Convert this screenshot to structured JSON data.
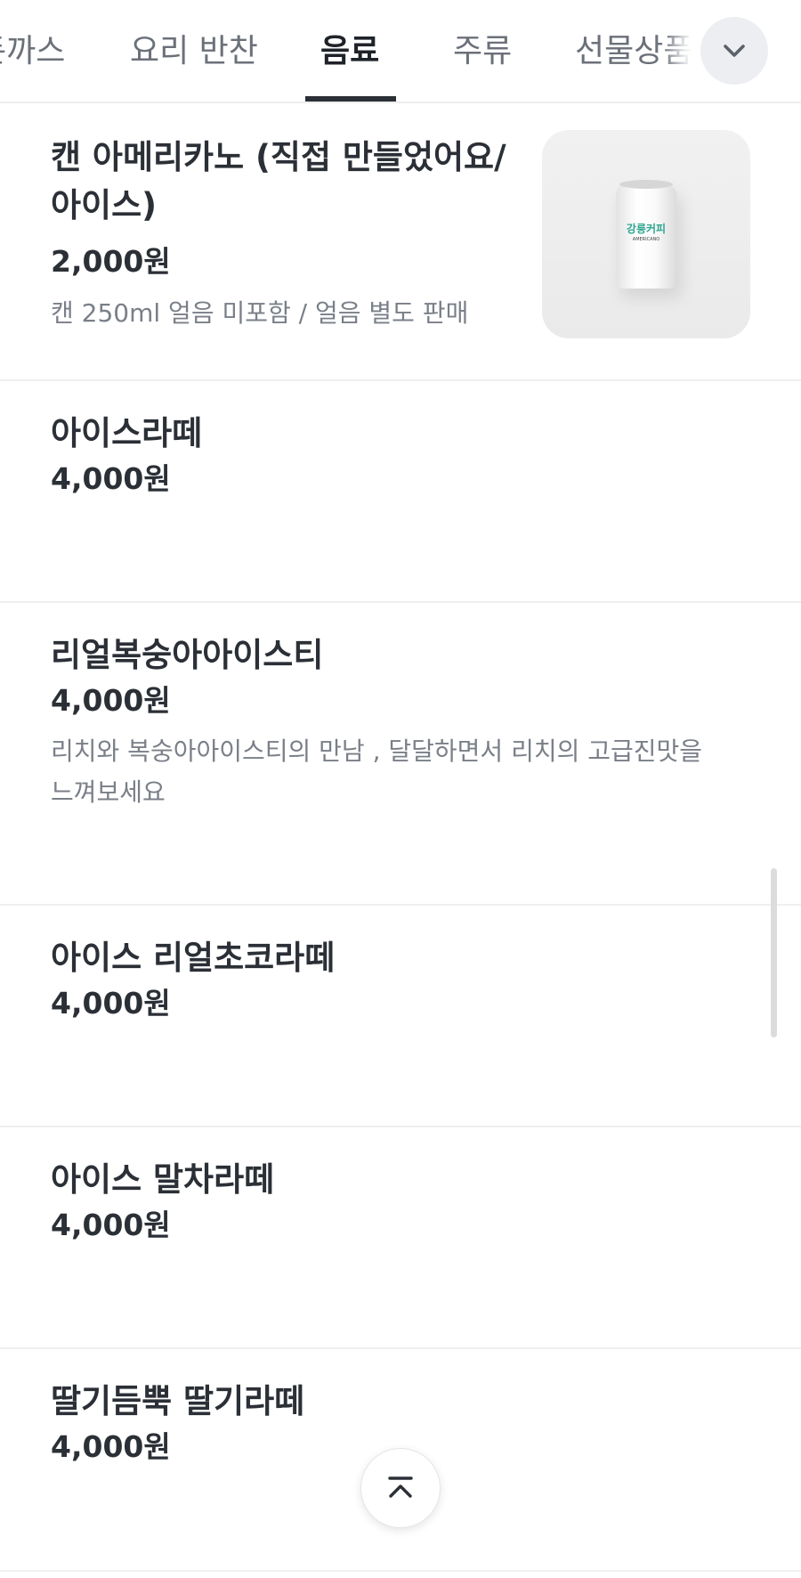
{
  "tabs": [
    {
      "label": "돈까스"
    },
    {
      "label": "요리 반찬"
    },
    {
      "label": "음료",
      "active": true
    },
    {
      "label": "주류"
    },
    {
      "label": "선물상품"
    }
  ],
  "icons": {
    "expand_tabs": "chevron-down-icon",
    "scroll_top": "chevron-up-icon"
  },
  "menu": [
    {
      "name_line1": "캔 아메리카노 (직접 만들었어요/",
      "name_line2": "아이스)",
      "price": "2,000원",
      "desc_line1": "캔 250ml 얼음 미포함 / 얼음 별도 판매",
      "image": {
        "brand": "강릉커피",
        "label": "AMERICANO"
      }
    },
    {
      "name_line1": "아이스라떼",
      "price": "4,000원"
    },
    {
      "name_line1": "리얼복숭아아이스티",
      "price": "4,000원",
      "desc_line1": "리치와 복숭아아이스티의 만남 ,  달달하면서 리치의 고급진맛을",
      "desc_line2": "느껴보세요"
    },
    {
      "name_line1": "아이스 리얼초코라떼",
      "price": "4,000원"
    },
    {
      "name_line1": "아이스 말차라떼",
      "price": "4,000원"
    },
    {
      "name_line1": "딸기듬뿍 딸기라떼",
      "price": "4,000원"
    }
  ],
  "colors": {
    "text_primary": "#2b2f36",
    "text_secondary": "#7a7f88",
    "tab_inactive": "#6b7079",
    "divider": "#efefef",
    "brand_green": "#2ea48f"
  }
}
